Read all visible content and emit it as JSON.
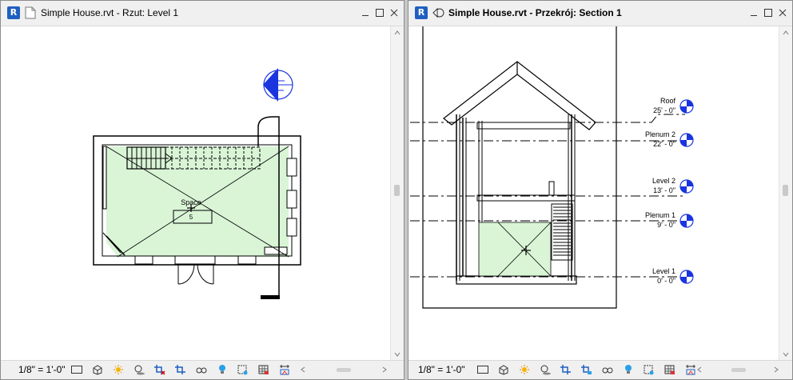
{
  "app": {
    "logo_letter": "R"
  },
  "left_view": {
    "title": "Simple House.rvt - Rzut: Level 1",
    "scale": "1/8\" = 1'-0\"",
    "space_label": "Space",
    "space_number": "5"
  },
  "right_view": {
    "title": "Simple House.rvt - Przekrój: Section 1",
    "scale": "1/8\" = 1'-0\"",
    "levels": [
      {
        "name": "Roof",
        "elevation": "25' - 0\""
      },
      {
        "name": "Plenum 2",
        "elevation": "22' - 0\""
      },
      {
        "name": "Level 2",
        "elevation": "13' - 0\""
      },
      {
        "name": "Plenum 1",
        "elevation": "9' - 0\""
      },
      {
        "name": "Level 1",
        "elevation": "0' - 0\""
      }
    ]
  },
  "colors": {
    "space_fill": "#d9f5d6",
    "revit_blue": "#1f5fc0",
    "marker_blue": "#1a35e0"
  },
  "icons": {
    "view_controls": [
      "detail-level-icon",
      "visual-style-icon",
      "sun-path-icon",
      "shadows-icon",
      "crop-view-icon",
      "show-crop-region-icon",
      "temporary-hide-icon",
      "reveal-hidden-icon",
      "lightbulb-icon",
      "highlight-displacement-icon",
      "analytical-model-icon",
      "constraints-icon"
    ]
  }
}
